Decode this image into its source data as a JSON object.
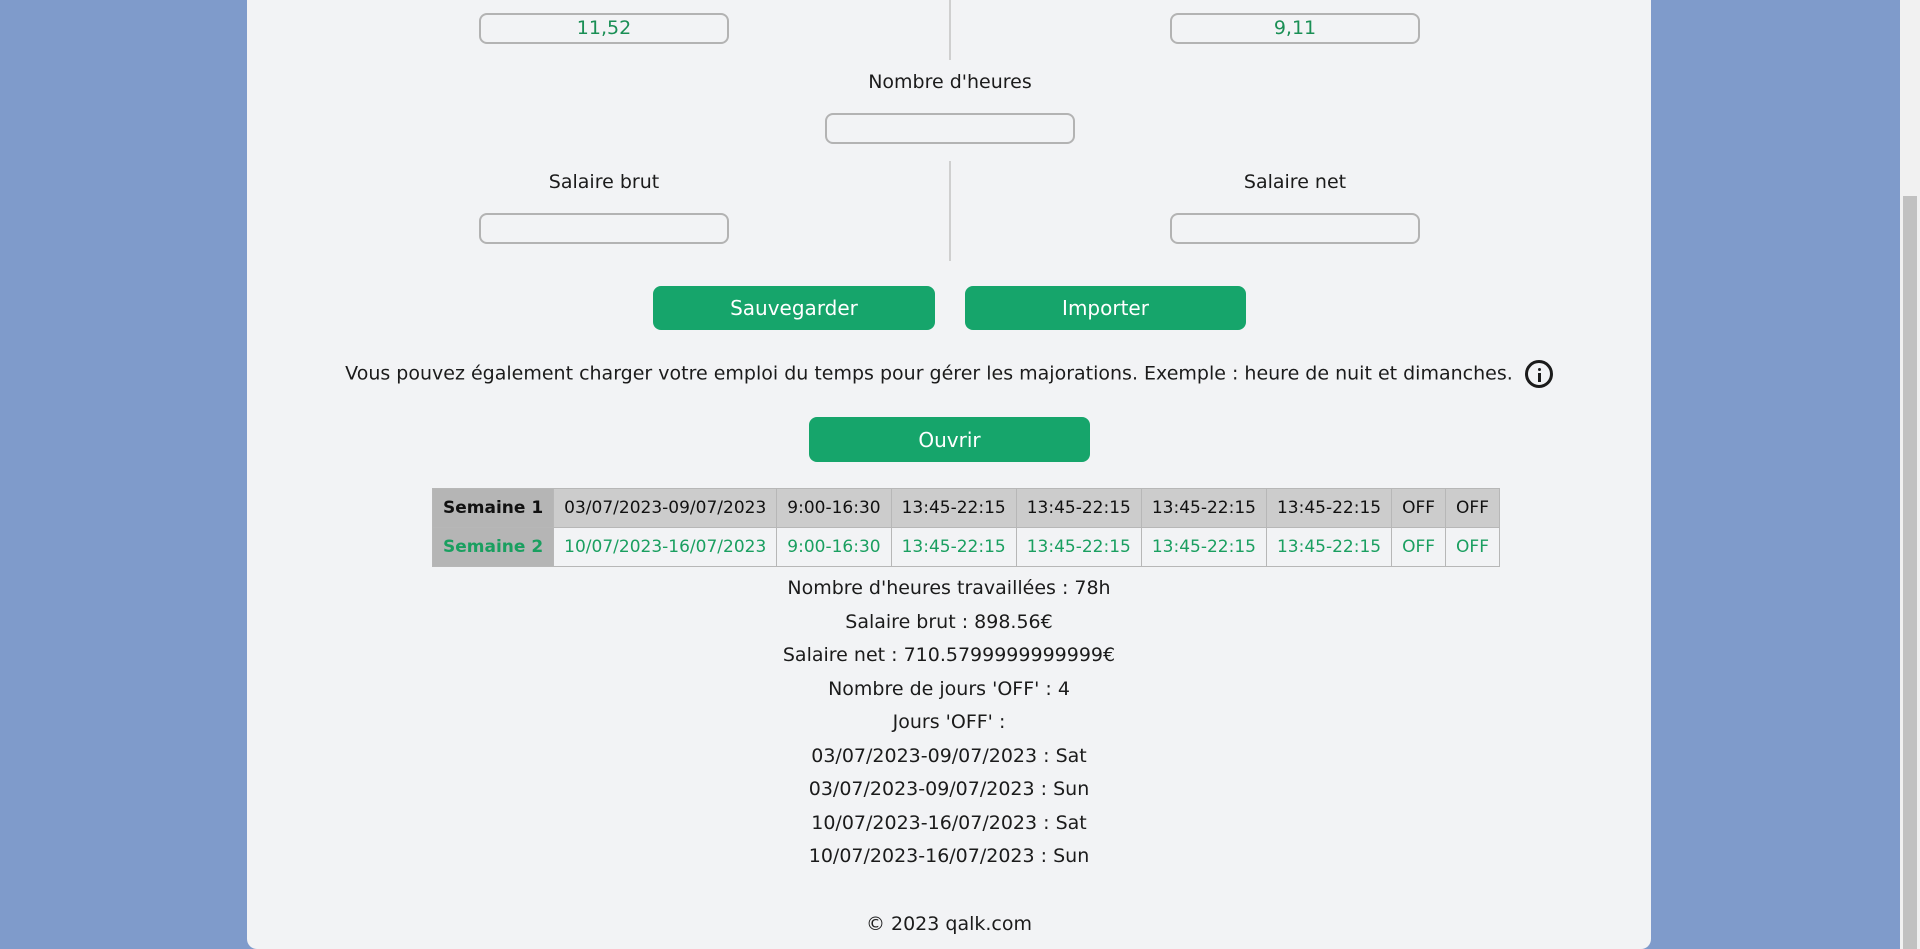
{
  "fields": {
    "taux_brut_value": "11,52",
    "taux_net_value": "9,11",
    "heures_label": "Nombre d'heures",
    "heures_value": "",
    "brut_label": "Salaire brut",
    "brut_value": "",
    "net_label": "Salaire net",
    "net_value": ""
  },
  "buttons": {
    "save": "Sauvegarder",
    "import": "Importer",
    "open": "Ouvrir"
  },
  "info_text": "Vous pouvez également charger votre emploi du temps pour gérer les majorations. Exemple : heure de nuit et dimanches.",
  "schedule": [
    {
      "week": "Semaine 1",
      "dates": "03/07/2023-09/07/2023",
      "days": [
        "9:00-16:30",
        "13:45-22:15",
        "13:45-22:15",
        "13:45-22:15",
        "13:45-22:15",
        "OFF",
        "OFF"
      ]
    },
    {
      "week": "Semaine 2",
      "dates": "10/07/2023-16/07/2023",
      "days": [
        "9:00-16:30",
        "13:45-22:15",
        "13:45-22:15",
        "13:45-22:15",
        "13:45-22:15",
        "OFF",
        "OFF"
      ]
    }
  ],
  "results": {
    "hours": "Nombre d'heures travaillées : 78h",
    "brut": "Salaire brut : 898.56€",
    "net": "Salaire net : 710.5799999999999€",
    "off_count": "Nombre de jours 'OFF' : 4",
    "off_title": "Jours 'OFF' :",
    "off_days": [
      "03/07/2023-09/07/2023 : Sat",
      "03/07/2023-09/07/2023 : Sun",
      "10/07/2023-16/07/2023 : Sat",
      "10/07/2023-16/07/2023 : Sun"
    ]
  },
  "footer": "© 2023 qalk.com",
  "colors": {
    "accent": "#16a56b",
    "background": "#7f9bcb",
    "card": "#f2f3f5"
  }
}
